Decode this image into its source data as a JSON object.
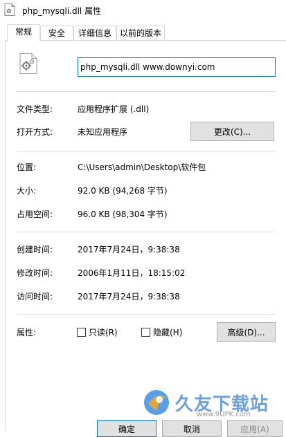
{
  "window": {
    "title": "php_mysqli.dll 属性"
  },
  "tabs": [
    {
      "label": "常规",
      "active": true
    },
    {
      "label": "安全",
      "active": false
    },
    {
      "label": "详细信息",
      "active": false
    },
    {
      "label": "以前的版本",
      "active": false
    }
  ],
  "file": {
    "name": "php_mysqli.dll www.downyi.com",
    "icon": "dll-file-gear-icon"
  },
  "type_section": {
    "file_type_label": "文件类型:",
    "file_type_value": "应用程序扩展 (.dll)",
    "opens_with_label": "打开方式:",
    "opens_with_value": "未知应用程序",
    "change_button": "更改(C)..."
  },
  "location_section": {
    "location_label": "位置:",
    "location_value": "C:\\Users\\admin\\Desktop\\软件包",
    "size_label": "大小:",
    "size_value": "92.0 KB (94,268 字节)",
    "disk_size_label": "占用空间:",
    "disk_size_value": "96.0 KB (98,304 字节)"
  },
  "time_section": {
    "created_label": "创建时间:",
    "created_value": "2017年7月24日，9:38:38",
    "modified_label": "修改时间:",
    "modified_value": "2006年1月11日，18:15:02",
    "accessed_label": "访问时间:",
    "accessed_value": "2017年7月24日，9:38:38"
  },
  "attributes": {
    "label": "属性:",
    "readonly_label": "只读(R)",
    "readonly_checked": false,
    "hidden_label": "隐藏(H)",
    "hidden_checked": false,
    "advanced_button": "高级(D)..."
  },
  "footer": {
    "ok_button": "确定",
    "cancel_button": "取消",
    "apply_button": "应用(A)"
  },
  "watermark": {
    "text": "久友下载站",
    "url": "www.9UPK.com"
  }
}
